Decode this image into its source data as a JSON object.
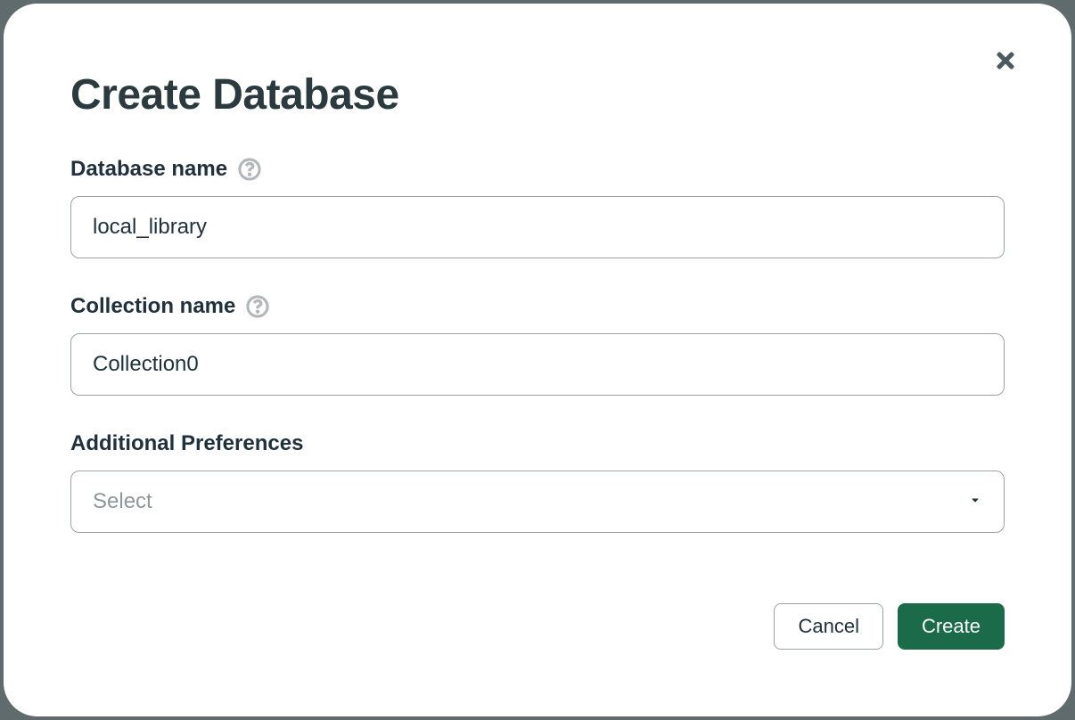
{
  "modal": {
    "title": "Create Database",
    "fields": {
      "database": {
        "label": "Database name",
        "value": "local_library"
      },
      "collection": {
        "label": "Collection name",
        "value": "Collection0"
      },
      "preferences": {
        "label": "Additional Preferences",
        "placeholder": "Select"
      }
    },
    "buttons": {
      "cancel": "Cancel",
      "create": "Create"
    }
  }
}
